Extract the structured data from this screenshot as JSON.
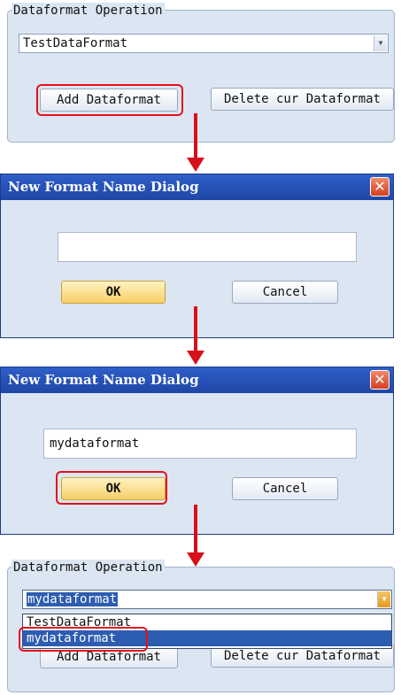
{
  "step1": {
    "group_title": "Dataformat Operation",
    "combo_value": "TestDataFormat",
    "add_button": "Add Dataformat",
    "delete_button": "Delete cur Dataformat"
  },
  "step2": {
    "dialog_title": "New Format Name Dialog",
    "close_glyph": "✕",
    "input_value": "",
    "ok_button": "OK",
    "cancel_button": "Cancel"
  },
  "step3": {
    "dialog_title": "New Format Name Dialog",
    "close_glyph": "✕",
    "input_value": "mydataformat",
    "ok_button": "OK",
    "cancel_button": "Cancel"
  },
  "step4": {
    "group_title": "Dataformat Operation",
    "combo_value": "mydataformat",
    "dropdown_items": [
      "TestDataFormat",
      "mydataformat"
    ],
    "add_button": "Add Dataformat",
    "delete_button": "Delete cur Dataformat"
  },
  "colors": {
    "highlight": "#e3101a",
    "arrow": "#d8101a",
    "titlebar": "#2a55b8",
    "selection": "#2d5db0"
  }
}
